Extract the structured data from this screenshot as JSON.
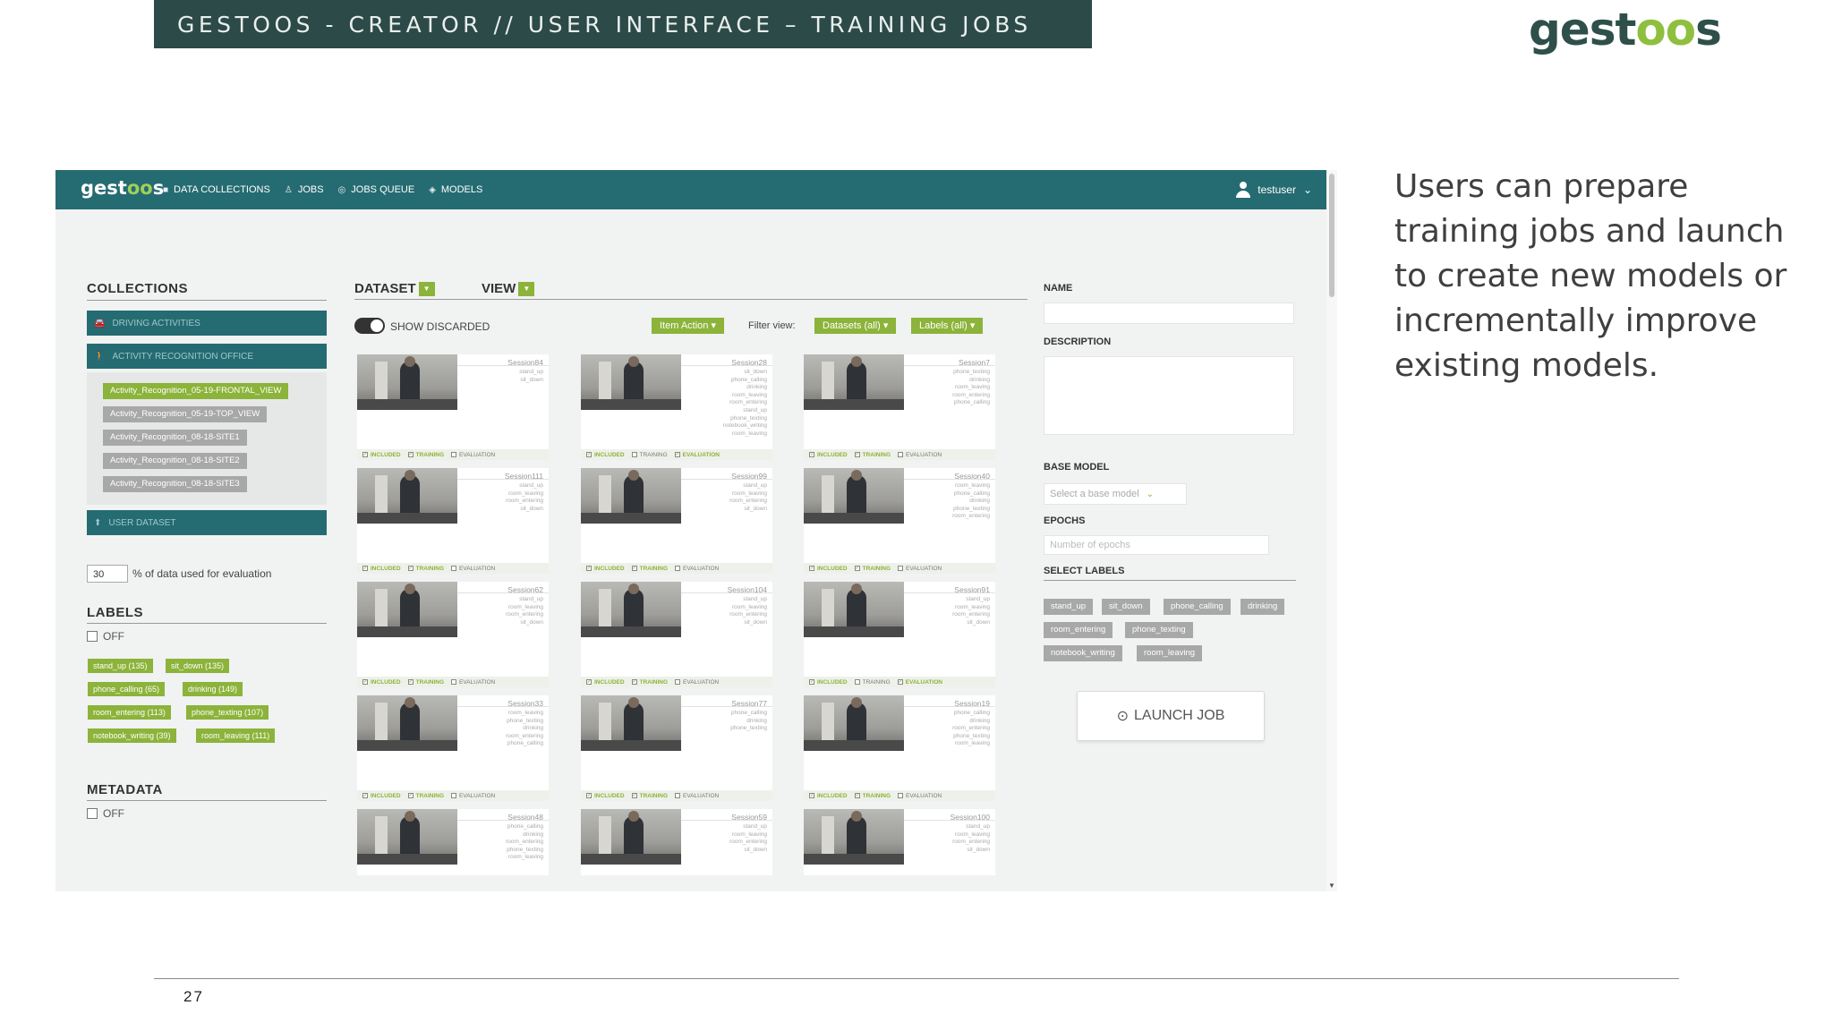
{
  "slide": {
    "title": "GESTOOS - CREATOR // USER INTERFACE – TRAINING JOBS",
    "logo_prefix": "gest",
    "logo_mid": "oo",
    "logo_suffix": "s",
    "description": "Users can prepare training jobs and launch to create new models or incrementally improve existing models.",
    "page_number": "27"
  },
  "app": {
    "nav": {
      "logo_prefix": "gest",
      "logo_mid": "oo",
      "logo_suffix": "s",
      "links": [
        {
          "label": "DATA COLLECTIONS",
          "icon": "database-icon"
        },
        {
          "label": "JOBS",
          "icon": "flask-icon"
        },
        {
          "label": "JOBS QUEUE",
          "icon": "queue-icon"
        },
        {
          "label": "MODELS",
          "icon": "model-icon"
        }
      ],
      "user": "testuser"
    },
    "collections": {
      "title": "COLLECTIONS",
      "groups": [
        "DRIVING ACTIVITIES",
        "ACTIVITY RECOGNITION OFFICE",
        "USER DATASET"
      ],
      "datasets": [
        {
          "label": "Activity_Recognition_05-19-FRONTAL_VIEW",
          "active": true
        },
        {
          "label": "Activity_Recognition_05-19-TOP_VIEW",
          "active": false
        },
        {
          "label": "Activity_Recognition_08-18-SITE1",
          "active": false
        },
        {
          "label": "Activity_Recognition_08-18-SITE2",
          "active": false
        },
        {
          "label": "Activity_Recognition_08-18-SITE3",
          "active": false
        }
      ],
      "eval_value": "30",
      "eval_label": "% of data used for evaluation"
    },
    "labels": {
      "title": "LABELS",
      "toggle": "OFF",
      "tags": [
        "stand_up (135)",
        "sit_down (135)",
        "phone_calling (65)",
        "drinking (149)",
        "room_entering (113)",
        "phone_texting (107)",
        "notebook_writing (39)",
        "room_leaving (111)"
      ]
    },
    "metadata": {
      "title": "METADATA",
      "toggle": "OFF"
    },
    "dataset": {
      "title": "DATASET",
      "view_title": "VIEW",
      "show_discarded": "SHOW DISCARDED",
      "item_action": "Item Action",
      "filter_label": "Filter view:",
      "datasets_filter": "Datasets (all)",
      "labels_filter": "Labels (all)",
      "foot_labels": [
        "INCLUDED",
        "TRAINING",
        "EVALUATION"
      ],
      "cards": [
        {
          "name": "Session84",
          "labels": [
            "stand_up",
            "sit_down"
          ],
          "flags": [
            true,
            true,
            false
          ]
        },
        {
          "name": "Session28",
          "labels": [
            "sit_down",
            "phone_calling",
            "drinking",
            "room_leaving",
            "room_entering",
            "stand_up",
            "phone_texting",
            "notebook_writing",
            "room_leaving"
          ],
          "flags": [
            true,
            false,
            true
          ]
        },
        {
          "name": "Session7",
          "labels": [
            "phone_texting",
            "drinking",
            "room_leaving",
            "room_entering",
            "phone_calling"
          ],
          "flags": [
            true,
            true,
            false
          ]
        },
        {
          "name": "Session111",
          "labels": [
            "stand_up",
            "room_leaving",
            "room_entering",
            "sit_down"
          ],
          "flags": [
            true,
            true,
            false
          ]
        },
        {
          "name": "Session99",
          "labels": [
            "stand_up",
            "room_leaving",
            "room_entering",
            "sit_down"
          ],
          "flags": [
            true,
            true,
            false
          ]
        },
        {
          "name": "Session40",
          "labels": [
            "room_leaving",
            "phone_calling",
            "drinking",
            "phone_texting",
            "room_entering"
          ],
          "flags": [
            true,
            true,
            false
          ]
        },
        {
          "name": "Session62",
          "labels": [
            "stand_up",
            "room_leaving",
            "room_entering",
            "sit_down"
          ],
          "flags": [
            true,
            true,
            false
          ]
        },
        {
          "name": "Session104",
          "labels": [
            "stand_up",
            "room_leaving",
            "room_entering",
            "sit_down"
          ],
          "flags": [
            true,
            true,
            false
          ]
        },
        {
          "name": "Session91",
          "labels": [
            "stand_up",
            "room_leaving",
            "room_entering",
            "sit_down"
          ],
          "flags": [
            true,
            false,
            true
          ]
        },
        {
          "name": "Session33",
          "labels": [
            "room_leaving",
            "phone_texting",
            "drinking",
            "room_entering",
            "phone_calling"
          ],
          "flags": [
            true,
            true,
            false
          ]
        },
        {
          "name": "Session77",
          "labels": [
            "phone_calling",
            "drinking",
            "phone_texting"
          ],
          "flags": [
            true,
            true,
            false
          ]
        },
        {
          "name": "Session19",
          "labels": [
            "phone_calling",
            "drinking",
            "room_entering",
            "phone_texting",
            "room_leaving"
          ],
          "flags": [
            true,
            true,
            false
          ]
        },
        {
          "name": "Session48",
          "labels": [
            "phone_calling",
            "drinking",
            "room_entering",
            "phone_texting",
            "room_leaving"
          ],
          "flags": [
            true,
            true,
            false
          ]
        },
        {
          "name": "Session59",
          "labels": [
            "stand_up",
            "room_leaving",
            "room_entering",
            "sit_down"
          ],
          "flags": [
            true,
            true,
            false
          ]
        },
        {
          "name": "Session100",
          "labels": [
            "stand_up",
            "room_leaving",
            "room_entering",
            "sit_down"
          ],
          "flags": [
            true,
            true,
            false
          ]
        }
      ]
    },
    "job": {
      "name_label": "NAME",
      "description_label": "DESCRIPTION",
      "base_model_label": "BASE MODEL",
      "base_model_placeholder": "Select a base model",
      "epochs_label": "EPOCHS",
      "epochs_placeholder": "Number of epochs",
      "select_labels_title": "SELECT LABELS",
      "select_labels": [
        "stand_up",
        "sit_down",
        "phone_calling",
        "drinking",
        "room_entering",
        "phone_texting",
        "notebook_writing",
        "room_leaving"
      ],
      "launch": "LAUNCH JOB"
    }
  }
}
